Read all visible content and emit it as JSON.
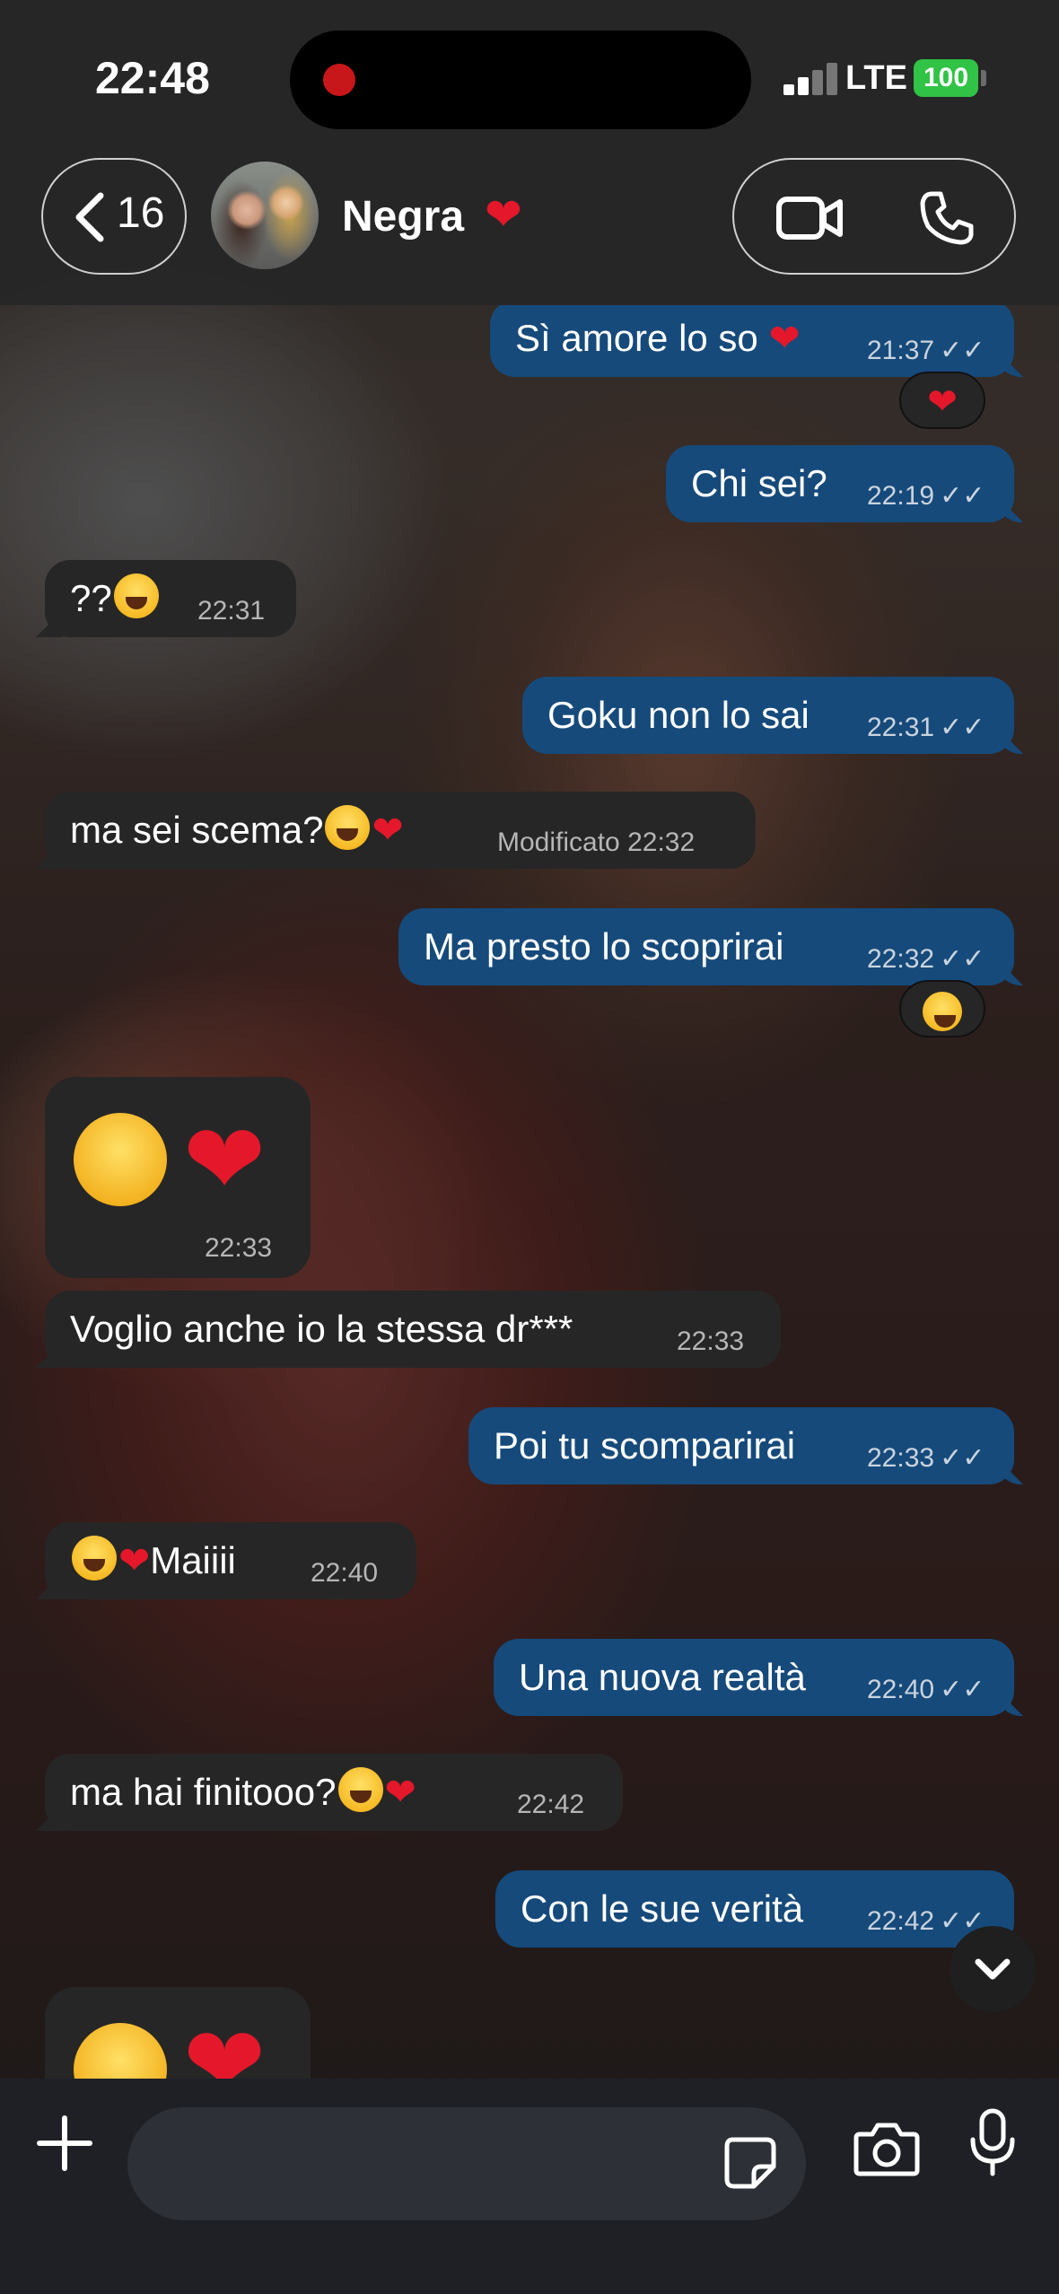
{
  "status_bar": {
    "time": "22:48",
    "network": "LTE",
    "battery": "100"
  },
  "header": {
    "back_count": "16",
    "contact_name": "Negra",
    "icons": [
      "chevron-left-icon",
      "video-call-icon",
      "phone-icon"
    ]
  },
  "messages": [
    {
      "dir": "out",
      "text": "Sì amore lo so",
      "time": "21:37",
      "reaction": "heart"
    },
    {
      "dir": "out",
      "text": "Chi sei?",
      "time": "22:19"
    },
    {
      "dir": "in",
      "text": "??",
      "time": "22:31"
    },
    {
      "dir": "out",
      "text": "Goku non lo sai",
      "time": "22:31"
    },
    {
      "dir": "in",
      "text": "ma sei scema?",
      "edited": "Modificato",
      "time": "22:32"
    },
    {
      "dir": "out",
      "text": "Ma presto lo scoprirai",
      "time": "22:32",
      "reaction": "laugh"
    },
    {
      "dir": "in",
      "text": "",
      "time": "22:33",
      "kind": "big-emoji"
    },
    {
      "dir": "in",
      "text": "Voglio anche io la stessa dr***",
      "time": "22:33"
    },
    {
      "dir": "out",
      "text": "Poi tu scomparirai",
      "time": "22:33"
    },
    {
      "dir": "in",
      "text": "Maiiii",
      "time": "22:40"
    },
    {
      "dir": "out",
      "text": "Una nuova realtà",
      "time": "22:40"
    },
    {
      "dir": "in",
      "text": "ma hai finitooo?",
      "time": "22:42"
    },
    {
      "dir": "out",
      "text": "Con le sue verità",
      "time": "22:42"
    }
  ],
  "composer": {
    "placeholder": ""
  },
  "colors": {
    "outgoing": "#164a7b",
    "incoming": "#272627",
    "heart": "#e4182a",
    "battery": "#31c345"
  }
}
